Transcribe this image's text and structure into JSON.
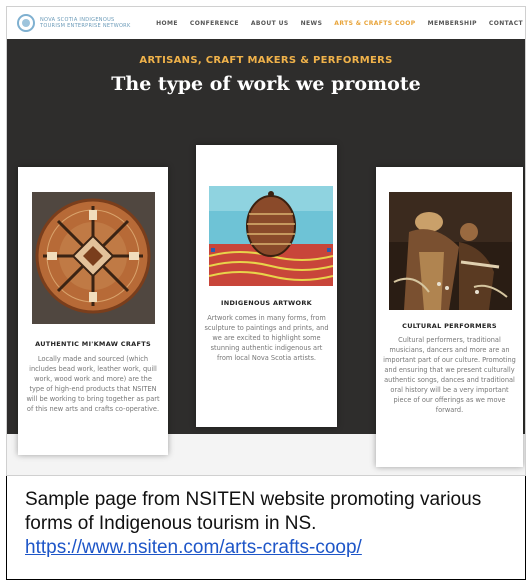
{
  "nav": {
    "logo_line1": "NOVA SCOTIA INDIGENOUS",
    "logo_line2": "TOURISM ENTERPRISE NETWORK",
    "items": [
      "HOME",
      "CONFERENCE",
      "ABOUT US",
      "NEWS",
      "ARTS & CRAFTS COOP",
      "MEMBERSHIP",
      "CONTACT"
    ],
    "active_item": "ARTS & CRAFTS COOP"
  },
  "hero": {
    "subtitle": "ARTISANS, CRAFT MAKERS & PERFORMERS",
    "title": "The type of work we promote"
  },
  "cards": [
    {
      "title": "AUTHENTIC MI'KMAW CRAFTS",
      "text": "Locally made and sourced (which includes bead work, leather work, quill work, wood work and more) are the type of high-end products that NSITEN will be working to bring together as part of this new arts and crafts co-operative.",
      "image_icon": "quillwork-basket-image"
    },
    {
      "title": "INDIGENOUS ARTWORK",
      "text": "Artwork comes in many forms, from sculpture to paintings and prints, and we are excited to highlight some stunning authentic indigenous art from local Nova Scotia artists.",
      "image_icon": "painting-image"
    },
    {
      "title": "CULTURAL PERFORMERS",
      "text": "Cultural performers, traditional musicians, dancers and more are an important part of our culture. Promoting and ensuring that we present culturally authentic songs, dances and traditional oral history will be a very important piece of our offerings as we move forward.",
      "image_icon": "dancers-image"
    }
  ],
  "caption": {
    "text": "Sample page from NSITEN website promoting various forms of Indigenous tourism in NS.",
    "link": "https://www.nsiten.com/arts-crafts-coop/"
  },
  "colors": {
    "accent": "#e8a43a",
    "hero_bg": "#2e2d2c",
    "link": "#1e56c8"
  }
}
